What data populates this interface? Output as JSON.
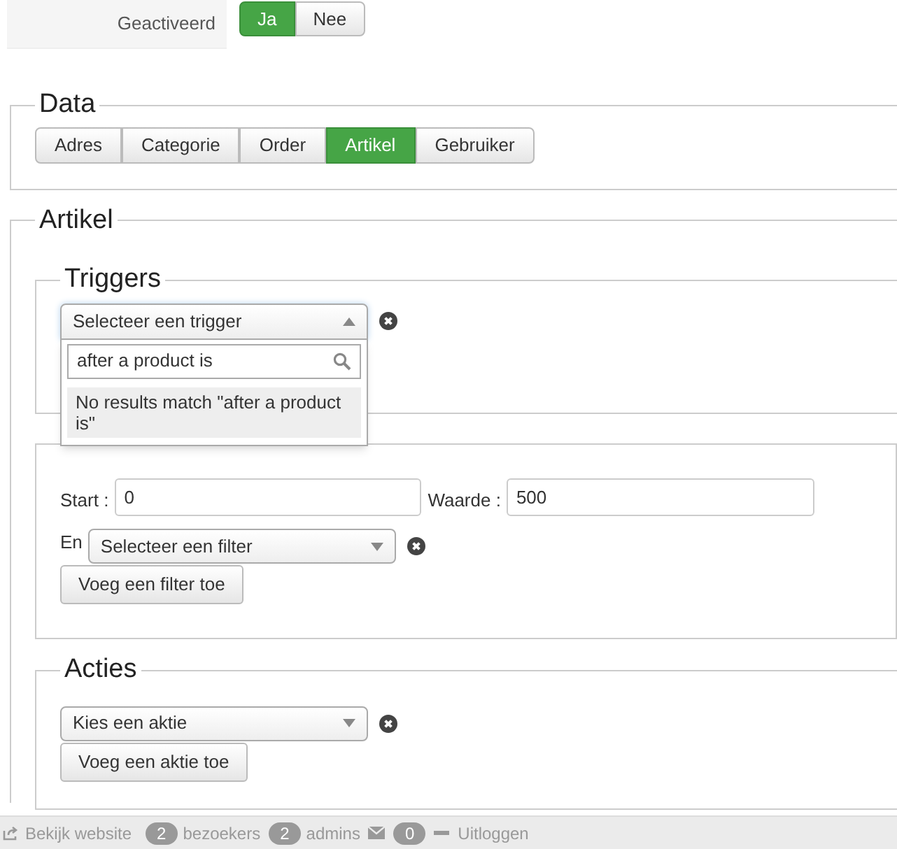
{
  "activation": {
    "label": "Geactiveerd",
    "options": [
      {
        "label": "Ja",
        "selected": true
      },
      {
        "label": "Nee",
        "selected": false
      }
    ]
  },
  "data_section": {
    "legend": "Data",
    "tabs": [
      {
        "label": "Adres",
        "selected": false
      },
      {
        "label": "Categorie",
        "selected": false
      },
      {
        "label": "Order",
        "selected": false
      },
      {
        "label": "Artikel",
        "selected": true
      },
      {
        "label": "Gebruiker",
        "selected": false
      }
    ]
  },
  "artikel_section": {
    "legend": "Artikel",
    "triggers": {
      "legend": "Triggers",
      "select": {
        "value": "Selecteer een trigger",
        "expanded": true,
        "search": "after a product is",
        "message": "No results match \"after a product is\""
      }
    },
    "filters": {
      "start_label": "Start :",
      "start_value": "0",
      "waarde_label": "Waarde :",
      "waarde_value": "500",
      "and_label": "En",
      "select": "Selecteer een filter",
      "button": "Voeg een filter toe"
    },
    "acties": {
      "legend": "Acties",
      "select": "Kies een aktie",
      "button": "Voeg een aktie toe"
    }
  },
  "footer": {
    "website_link": "Bekijk website",
    "visitors": {
      "count": "2",
      "label": "bezoekers"
    },
    "admins": {
      "count": "2",
      "label": "admins"
    },
    "messages": {
      "count": "0"
    },
    "logout": "Uitloggen"
  }
}
